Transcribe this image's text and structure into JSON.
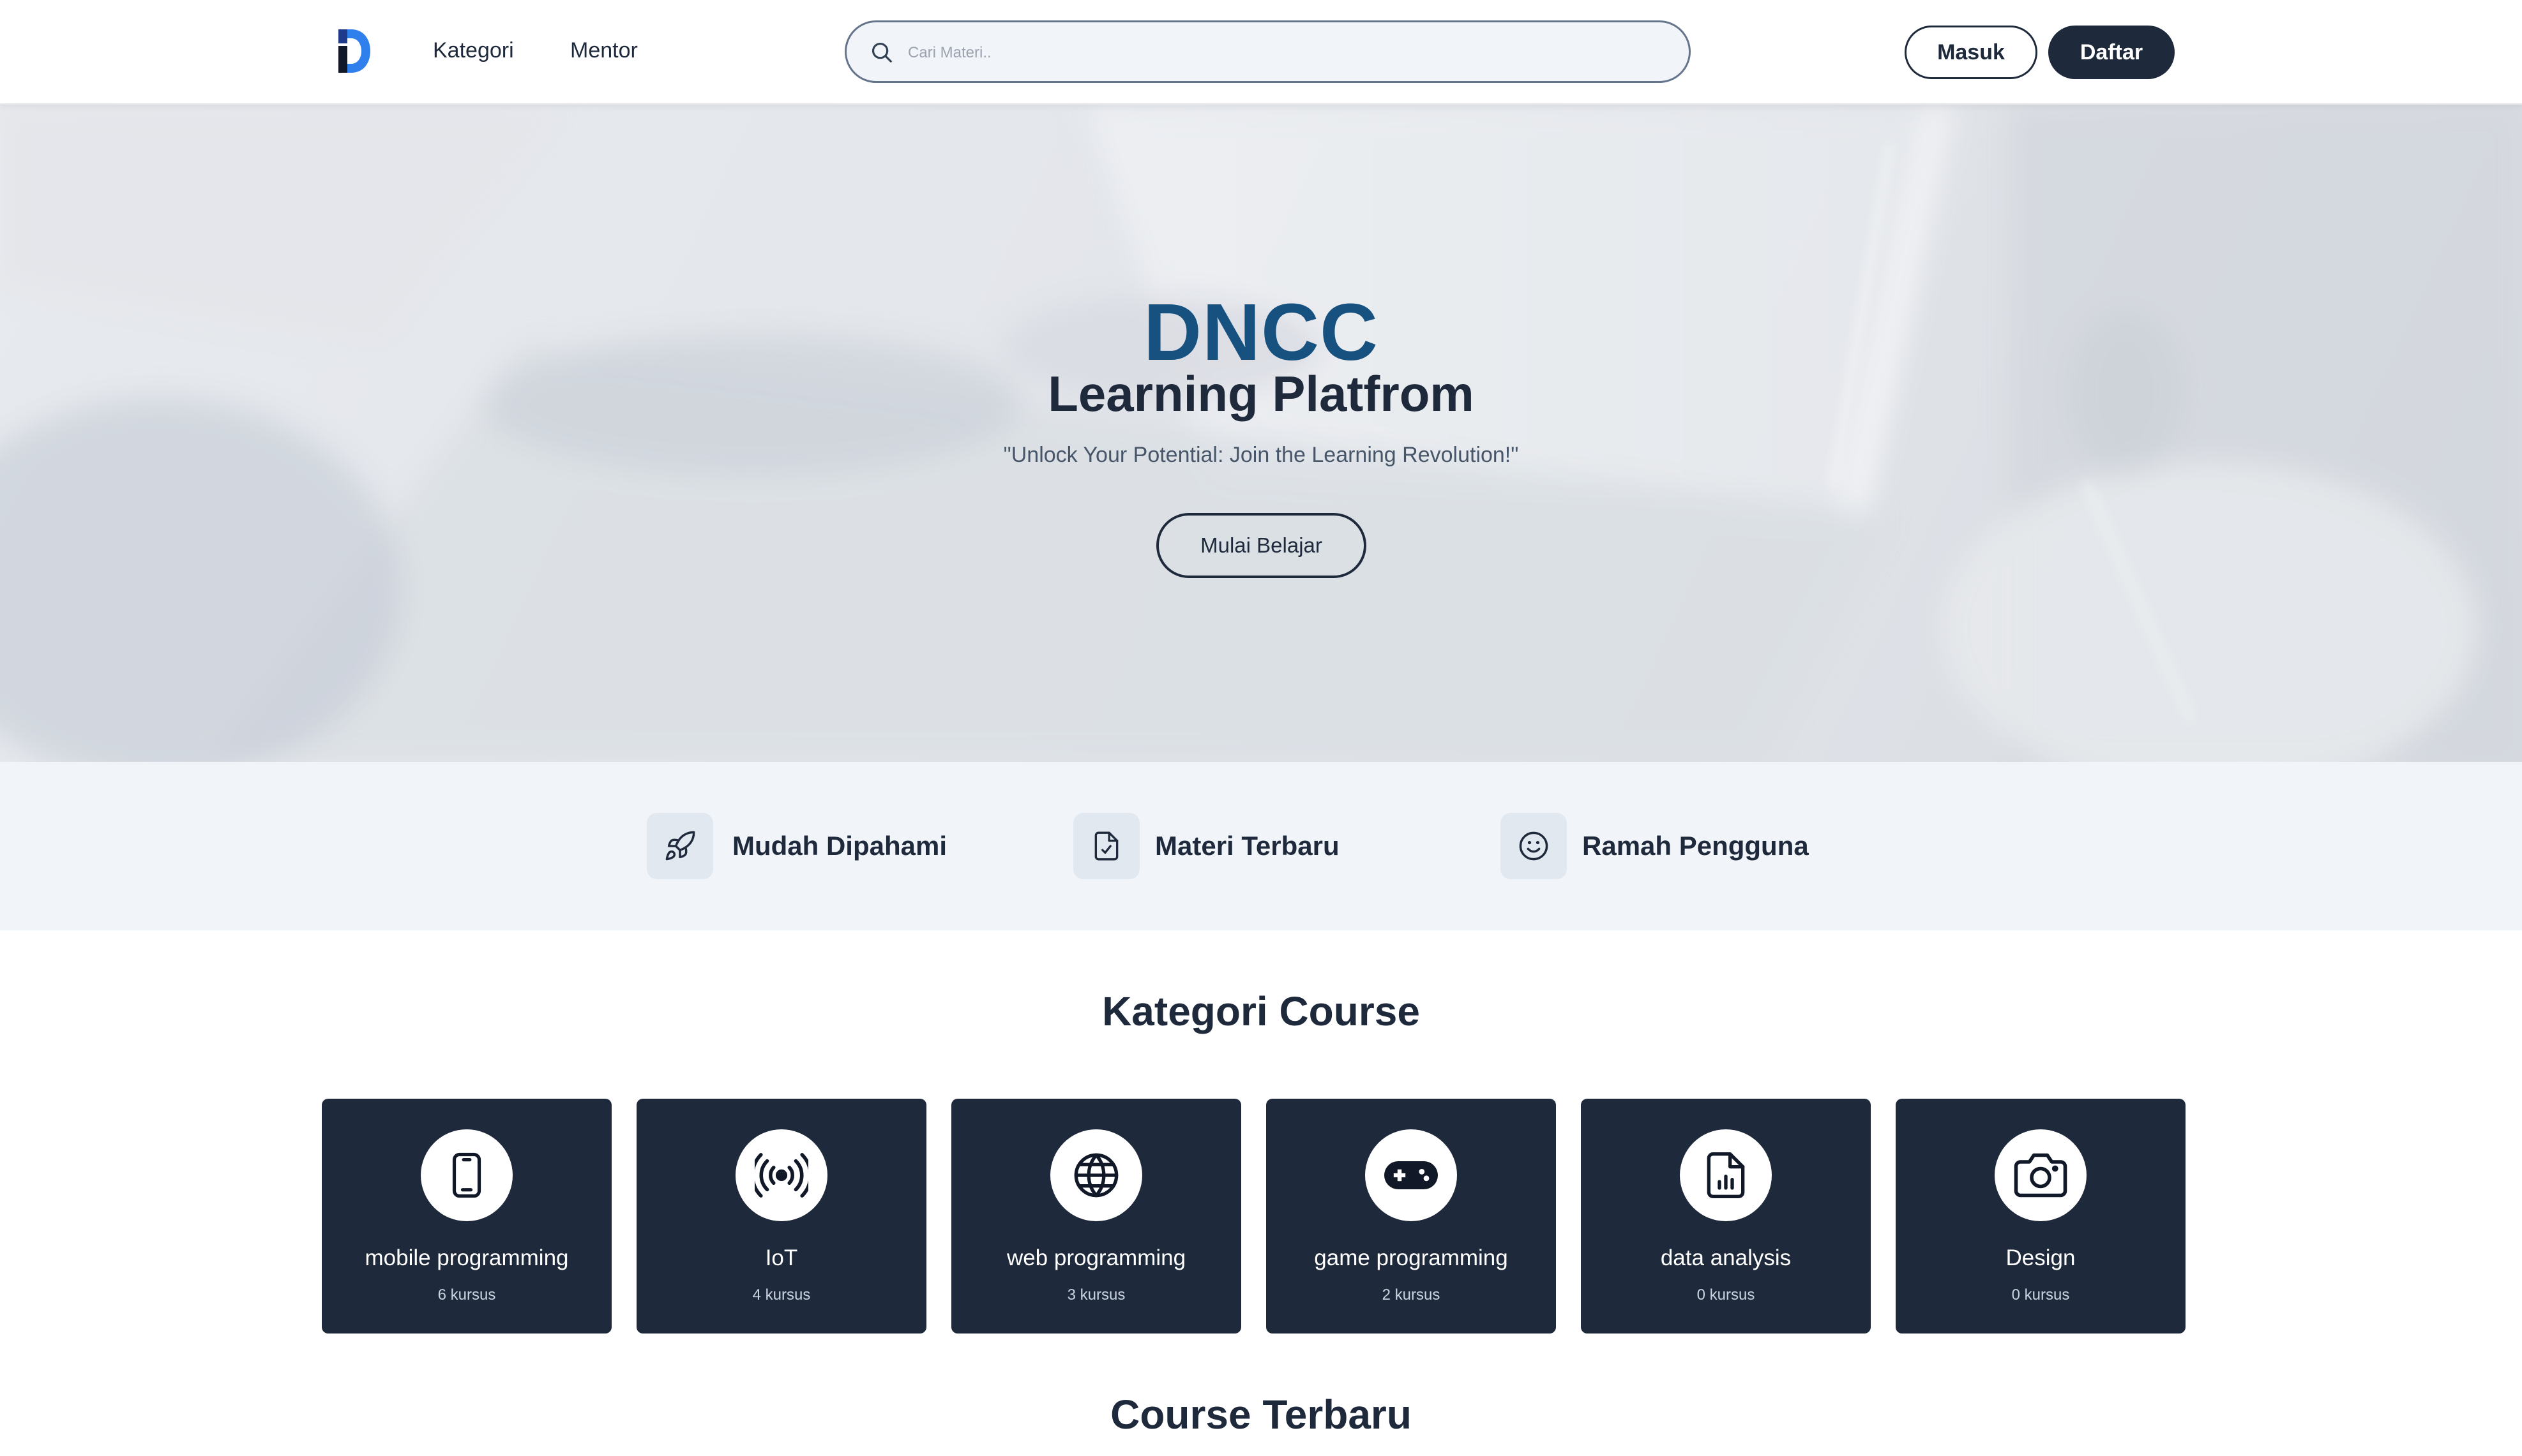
{
  "nav": {
    "links": [
      "Kategori",
      "Mentor"
    ],
    "search_placeholder": "Cari Materi..",
    "login_label": "Masuk",
    "register_label": "Daftar"
  },
  "hero": {
    "title": "DNCC",
    "subtitle": "Learning Platfrom",
    "tagline": "\"Unlock Your Potential: Join the Learning Revolution!\"",
    "cta_label": "Mulai Belajar"
  },
  "features": [
    {
      "label": "Mudah Dipahami",
      "icon": "rocket-icon"
    },
    {
      "label": "Materi Terbaru",
      "icon": "document-check-icon"
    },
    {
      "label": "Ramah Pengguna",
      "icon": "smiley-icon"
    }
  ],
  "categories": {
    "title": "Kategori Course",
    "items": [
      {
        "name": "mobile programming",
        "count": "6 kursus",
        "icon": "smartphone-icon"
      },
      {
        "name": "IoT",
        "count": "4 kursus",
        "icon": "broadcast-icon"
      },
      {
        "name": "web programming",
        "count": "3 kursus",
        "icon": "globe-icon"
      },
      {
        "name": "game programming",
        "count": "2 kursus",
        "icon": "gamepad-icon"
      },
      {
        "name": "data analysis",
        "count": "0 kursus",
        "icon": "chart-file-icon"
      },
      {
        "name": "Design",
        "count": "0 kursus",
        "icon": "camera-icon"
      }
    ]
  },
  "latest_courses": {
    "title": "Course Terbaru"
  },
  "colors": {
    "primary_dark": "#1e293b",
    "brand_blue": "#17517f",
    "logo_blue": "#2563eb",
    "feature_bg": "#f1f5f9"
  }
}
